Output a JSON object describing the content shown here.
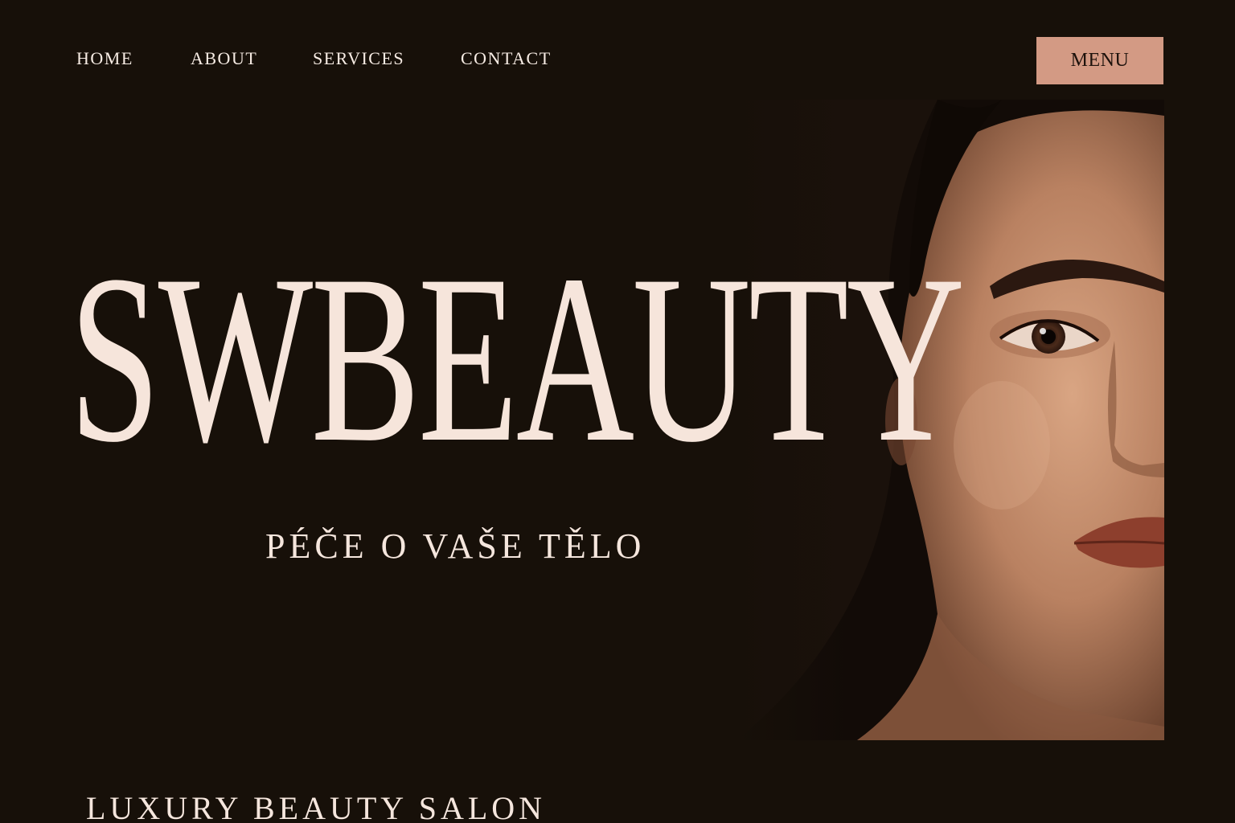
{
  "nav": {
    "items": [
      {
        "label": "HOME"
      },
      {
        "label": "ABOUT"
      },
      {
        "label": "SERVICES"
      },
      {
        "label": "CONTACT"
      }
    ]
  },
  "menu_button": {
    "label": "MENU"
  },
  "hero": {
    "brand": "SWBEAUTY",
    "tagline": "PÉČE O VAŠE TĚLO",
    "subtitle": "LUXURY BEAUTY SALON"
  },
  "colors": {
    "background": "#171009",
    "text": "#f6e5db",
    "accent": "#d39a84"
  }
}
